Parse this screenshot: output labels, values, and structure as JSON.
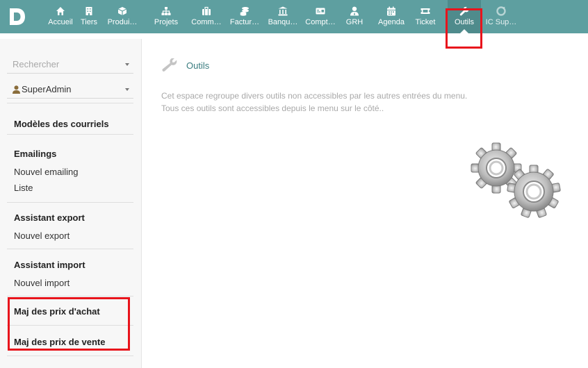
{
  "app": {
    "logo_letter": "D"
  },
  "topmenu": [
    {
      "label": "Accueil",
      "icon": "home-icon"
    },
    {
      "label": "Tiers",
      "icon": "building-icon"
    },
    {
      "label": "Produi…",
      "icon": "cube-icon"
    },
    {
      "label": "Projets",
      "icon": "sitemap-icon"
    },
    {
      "label": "Comm…",
      "icon": "suitcase-icon"
    },
    {
      "label": "Factur…",
      "icon": "coins-icon"
    },
    {
      "label": "Banqu…",
      "icon": "bank-icon"
    },
    {
      "label": "Compt…",
      "icon": "money-check-icon"
    },
    {
      "label": "GRH",
      "icon": "user-tie-icon"
    },
    {
      "label": "Agenda",
      "icon": "calendar-icon"
    },
    {
      "label": "Ticket",
      "icon": "ticket-icon"
    },
    {
      "label": "Outils",
      "icon": "wrench-icon",
      "active": true
    },
    {
      "label": "IC Sup…",
      "icon": "support-icon"
    }
  ],
  "sidebar": {
    "search_placeholder": "Rechercher",
    "user": "SuperAdmin",
    "sections": {
      "modeles": {
        "title": "Modèles des courriels"
      },
      "emailings": {
        "title": "Emailings",
        "links": [
          "Nouvel emailing",
          "Liste"
        ]
      },
      "export": {
        "title": "Assistant export",
        "links": [
          "Nouvel export"
        ]
      },
      "import": {
        "title": "Assistant import",
        "links": [
          "Nouvel import"
        ]
      },
      "prix_achat": {
        "title": "Maj des prix d'achat"
      },
      "prix_vente": {
        "title": "Maj des prix de vente"
      }
    }
  },
  "main": {
    "title": "Outils",
    "description_line1": "Cet espace regroupe divers outils non accessibles par les autres entrées du menu.",
    "description_line2": "Tous ces outils sont accessibles depuis le menu sur le côté.."
  },
  "colors": {
    "topbar": "#5e9fa0",
    "accent": "#3a7d80",
    "highlight": "#e8141c"
  }
}
